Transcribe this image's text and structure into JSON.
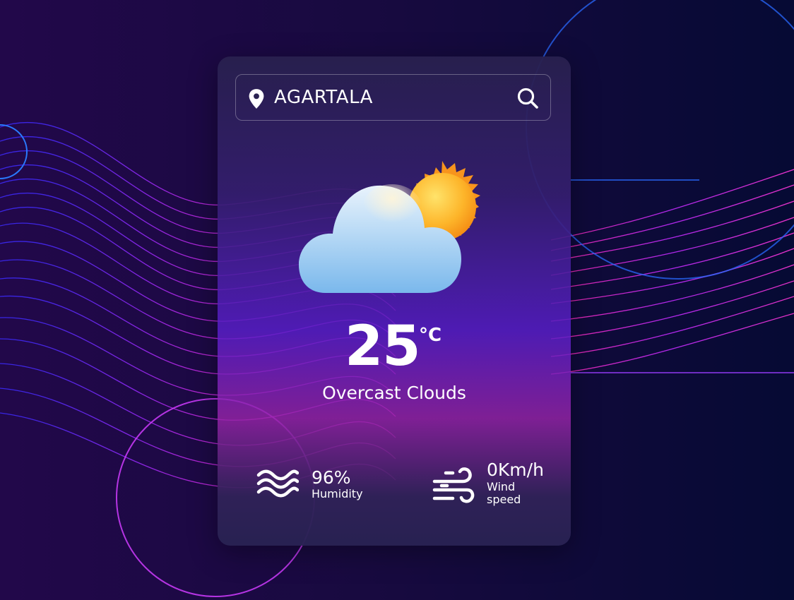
{
  "search": {
    "city": "AGARTALA",
    "icon_left": "map-pin-icon",
    "icon_right": "search-icon"
  },
  "weather": {
    "temperature": "25",
    "unit": "°C",
    "description": "Overcast Clouds",
    "icon": "cloud-sun-icon"
  },
  "humidity": {
    "value": "96%",
    "label": "Humidity",
    "icon": "waves-icon"
  },
  "wind": {
    "value": "0Km/h",
    "label_line1": "Wind",
    "label_line2": "speed",
    "icon": "wind-icon"
  },
  "colors": {
    "background": "#12063a",
    "card_top": "#28204e",
    "card_mid": "#5a1ec8",
    "card_glow": "#9624a8",
    "text": "#ffffff",
    "sun": "#f7a21b",
    "cloud": "#8cc4f0"
  }
}
